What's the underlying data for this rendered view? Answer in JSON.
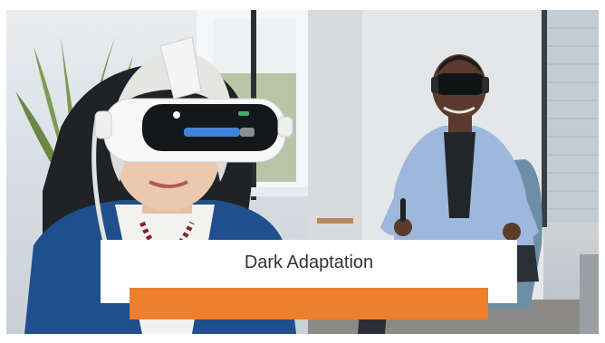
{
  "slide": {
    "title": "Dark Adaptation",
    "accent_color": "#ee7f2d",
    "images": {
      "left": "woman-wearing-vr-headset-photo",
      "right": "man-seated-with-vr-headset-photo"
    }
  }
}
